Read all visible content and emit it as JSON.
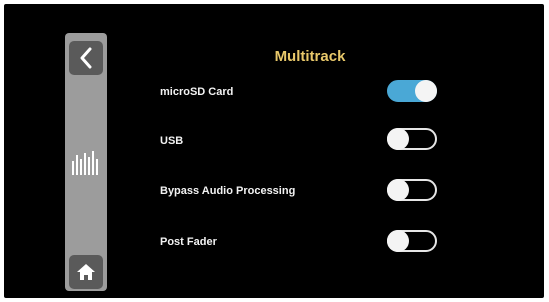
{
  "header": {
    "title": "Multitrack"
  },
  "sidebar": {
    "back_icon": "chevron-left-icon",
    "meter_icon": "equalizer-bars-icon",
    "home_icon": "home-icon"
  },
  "settings": [
    {
      "label": "microSD Card",
      "enabled": true
    },
    {
      "label": "USB",
      "enabled": false
    },
    {
      "label": "Bypass Audio Processing",
      "enabled": false
    },
    {
      "label": "Post Fader",
      "enabled": false
    }
  ],
  "colors": {
    "background": "#000000",
    "sidebar": "#9c9c9c",
    "sidebar_button": "#5a5a5a",
    "title": "#e8c86a",
    "toggle_on": "#4aa8d6",
    "toggle_off_border": "#e6e6e6",
    "label": "#f2f2f2"
  }
}
